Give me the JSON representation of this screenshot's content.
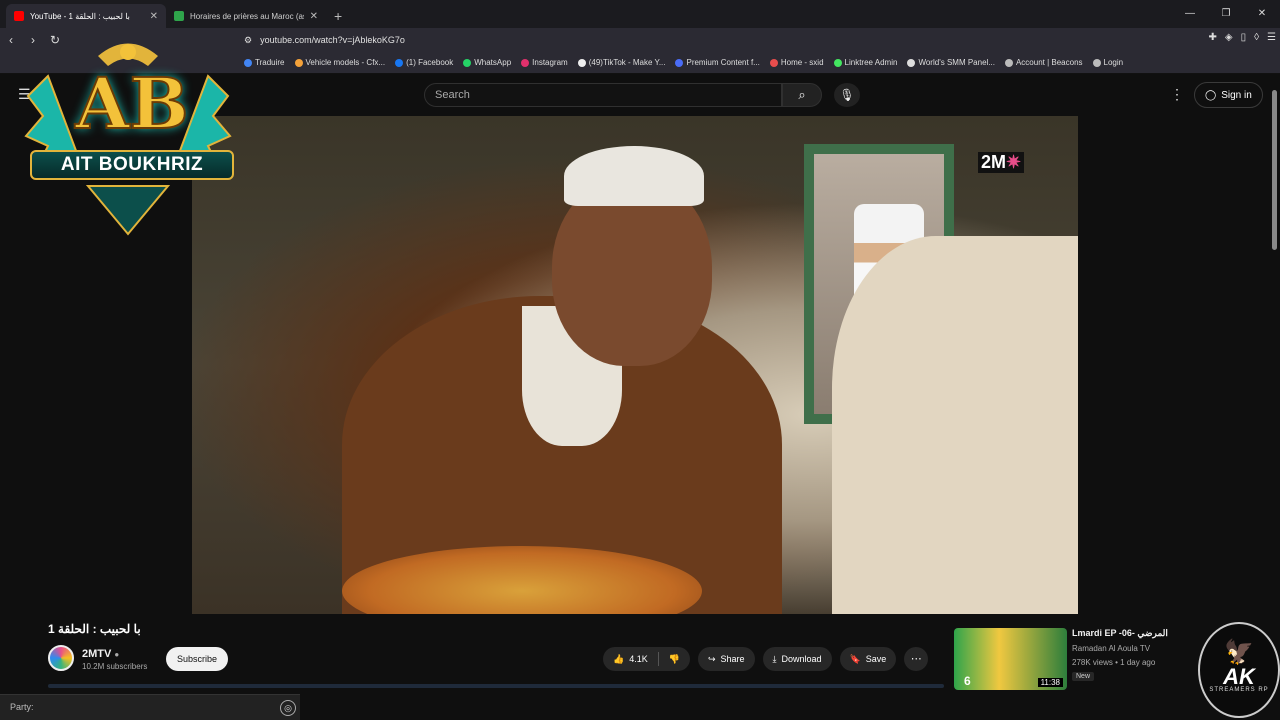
{
  "browser": {
    "tabs": [
      {
        "title": "YouTube - با لحبيب : الحلقة 1",
        "active": true,
        "favicon_color": "#ff0000"
      },
      {
        "title": "Horaires de prières au Maroc (as sobh...",
        "active": false,
        "favicon_color": "#2fa44b"
      }
    ],
    "new_tab": "+",
    "window_controls": [
      "—",
      "❐",
      "✕"
    ],
    "url": "youtube.com/watch?v=jAblekoKG7o",
    "bookmarks": [
      {
        "label": "Traduire",
        "color": "#4285f4"
      },
      {
        "label": "Vehicle models - Cfx...",
        "color": "#f4a23a"
      },
      {
        "label": "(1) Facebook",
        "color": "#1877f2"
      },
      {
        "label": "WhatsApp",
        "color": "#25d366"
      },
      {
        "label": "Instagram",
        "color": "#e1306c"
      },
      {
        "label": "(49)TikTok - Make Y...",
        "color": "#eeeeee"
      },
      {
        "label": "Premium Content f...",
        "color": "#4a6cf7"
      },
      {
        "label": "Home - sxid",
        "color": "#e84d4d"
      },
      {
        "label": "Linktree Admin",
        "color": "#43e660"
      },
      {
        "label": "World's SMM Panel...",
        "color": "#dddddd"
      },
      {
        "label": "Account | Beacons",
        "color": "#bbbbbb"
      },
      {
        "label": "Login",
        "color": "#bbbbbb"
      }
    ]
  },
  "youtube": {
    "search_placeholder": "Search",
    "sign_in": "Sign in",
    "video": {
      "title": "با لحبيب : الحلقة 1",
      "channel_logo_text": "2M",
      "channel": "2MTV",
      "subscribers": "10.2M subscribers",
      "subscribe": "Subscribe",
      "likes": "4.1K",
      "share": "Share",
      "download": "Download",
      "save": "Save"
    },
    "recommended": {
      "title": "Lmardi EP -06- المرضي",
      "channel": "Ramadan Al Aoula TV",
      "meta": "278K views • 1 day ago",
      "badge": "New",
      "duration": "11:38",
      "episode": "6"
    }
  },
  "overlay": {
    "ab_letters": "AB",
    "ab_name": "AIT BOUKHRIZ",
    "ak_text": "AK",
    "ak_sub": "STREAMERS RP"
  },
  "party_bar": {
    "label": "Party:"
  }
}
